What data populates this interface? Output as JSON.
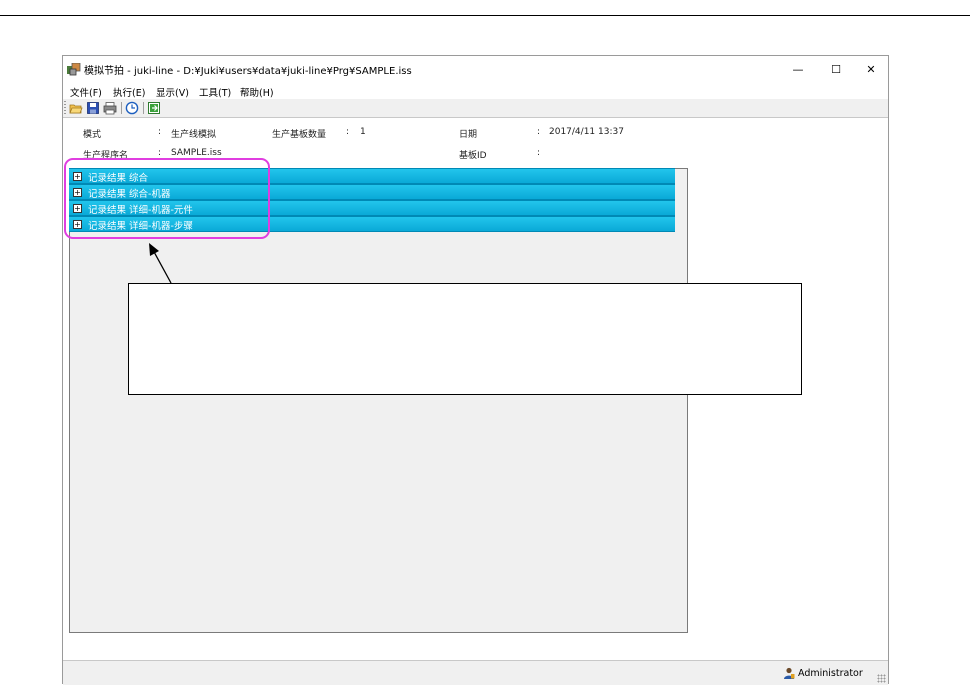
{
  "window": {
    "title": "模拟节拍 - juki-line - D:¥Juki¥users¥data¥juki-line¥Prg¥SAMPLE.iss",
    "minimize": "—",
    "maximize": "☐",
    "close": "✕"
  },
  "menu": [
    "文件(F)",
    "执行(E)",
    "显示(V)",
    "工具(T)",
    "帮助(H)"
  ],
  "toolbar": {
    "icons": [
      "open-folder-icon",
      "save-icon",
      "print-icon",
      "clock-icon",
      "export-icon"
    ]
  },
  "info": {
    "mode_label": "模式",
    "mode_value": "生产线模拟",
    "board_count_label": "生产基板数量",
    "board_count_value": "1",
    "date_label": "日期",
    "date_value": "2017/4/11 13:37",
    "program_label": "生产程序名",
    "program_value": "SAMPLE.iss",
    "board_id_label": "基板ID",
    "board_id_value": "",
    "sep": ":"
  },
  "sections": [
    {
      "label": "记录结果 综合",
      "expand": "+"
    },
    {
      "label": "记录结果 综合-机器",
      "expand": "+"
    },
    {
      "label": "记录结果 详细-机器-元件",
      "expand": "+"
    },
    {
      "label": "记录结果 详细-机器-步骤",
      "expand": "+"
    }
  ],
  "status": {
    "user": "Administrator"
  },
  "colors": {
    "section_bar": "#0aa9d7",
    "highlight": "#e03ee0"
  }
}
